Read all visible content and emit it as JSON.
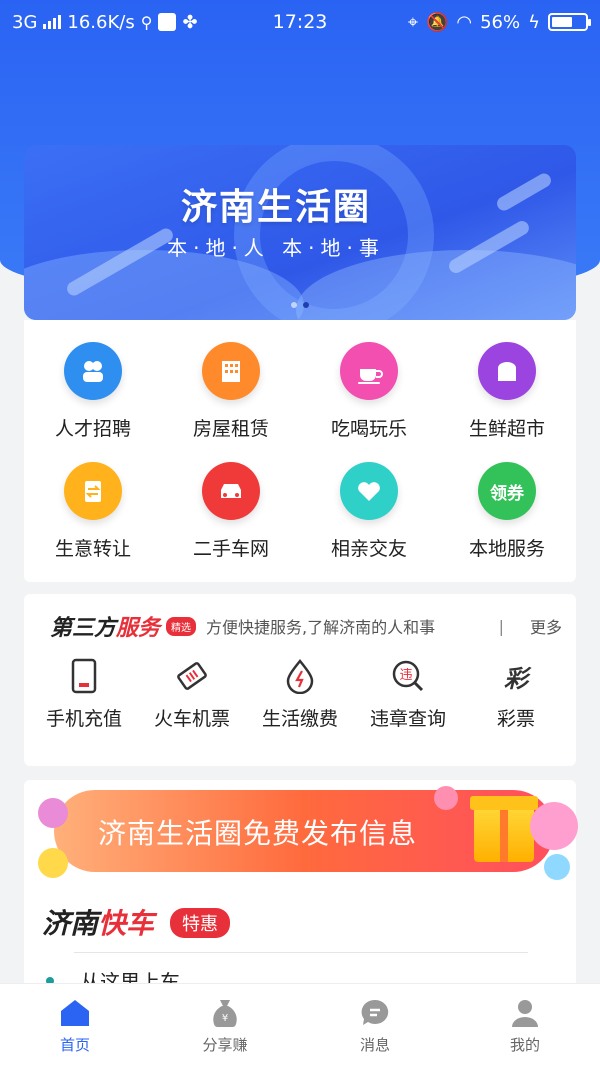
{
  "status_bar": {
    "network": "3G",
    "speed": "16.6K/s",
    "time": "17:23",
    "battery": "56%"
  },
  "banner": {
    "title": "济南生活圈",
    "subtitle": "本·地·人 本·地·事"
  },
  "categories": [
    {
      "label": "人才招聘",
      "icon": "talent-icon",
      "color": "#2f8ff0"
    },
    {
      "label": "房屋租赁",
      "icon": "building-icon",
      "color": "#ff8a2b"
    },
    {
      "label": "吃喝玩乐",
      "icon": "coffee-cup-icon",
      "color": "#f24fb0"
    },
    {
      "label": "生鲜超市",
      "icon": "bread-icon",
      "color": "#9b44e0"
    },
    {
      "label": "生意转让",
      "icon": "transfer-doc-icon",
      "color": "#ffb21c"
    },
    {
      "label": "二手车网",
      "icon": "car-icon",
      "color": "#f03a3a"
    },
    {
      "label": "相亲交友",
      "icon": "heart-icon",
      "color": "#2fd0c8"
    },
    {
      "label": "本地服务",
      "icon": "coupon-icon",
      "color": "#33c25a",
      "badge": "领券"
    }
  ],
  "services": {
    "title_main": "第三方",
    "title_accent": "服务",
    "tag": "精选",
    "description": "方便快捷服务,了解济南的人和事",
    "separator": "|",
    "more": "更多",
    "items": [
      {
        "label": "手机充值",
        "icon": "phone-icon"
      },
      {
        "label": "火车机票",
        "icon": "ticket-icon"
      },
      {
        "label": "生活缴费",
        "icon": "power-drop-icon"
      },
      {
        "label": "违章查询",
        "icon": "violation-search-icon",
        "glyph": "违"
      },
      {
        "label": "彩票",
        "icon": "lottery-icon",
        "glyph": "彩"
      }
    ]
  },
  "promo": {
    "text": "济南生活圈免费发布信息"
  },
  "express": {
    "title_main": "济南",
    "title_accent": "快车",
    "tag": "特惠",
    "item": "从这里上车"
  },
  "tabbar": [
    {
      "label": "首页",
      "icon": "home-icon",
      "active": true
    },
    {
      "label": "分享赚",
      "icon": "money-bag-icon",
      "active": false
    },
    {
      "label": "消息",
      "icon": "message-icon",
      "active": false
    },
    {
      "label": "我的",
      "icon": "user-icon",
      "active": false
    }
  ],
  "colors": {
    "primary": "#2b63f3",
    "accent_red": "#e8303a"
  }
}
